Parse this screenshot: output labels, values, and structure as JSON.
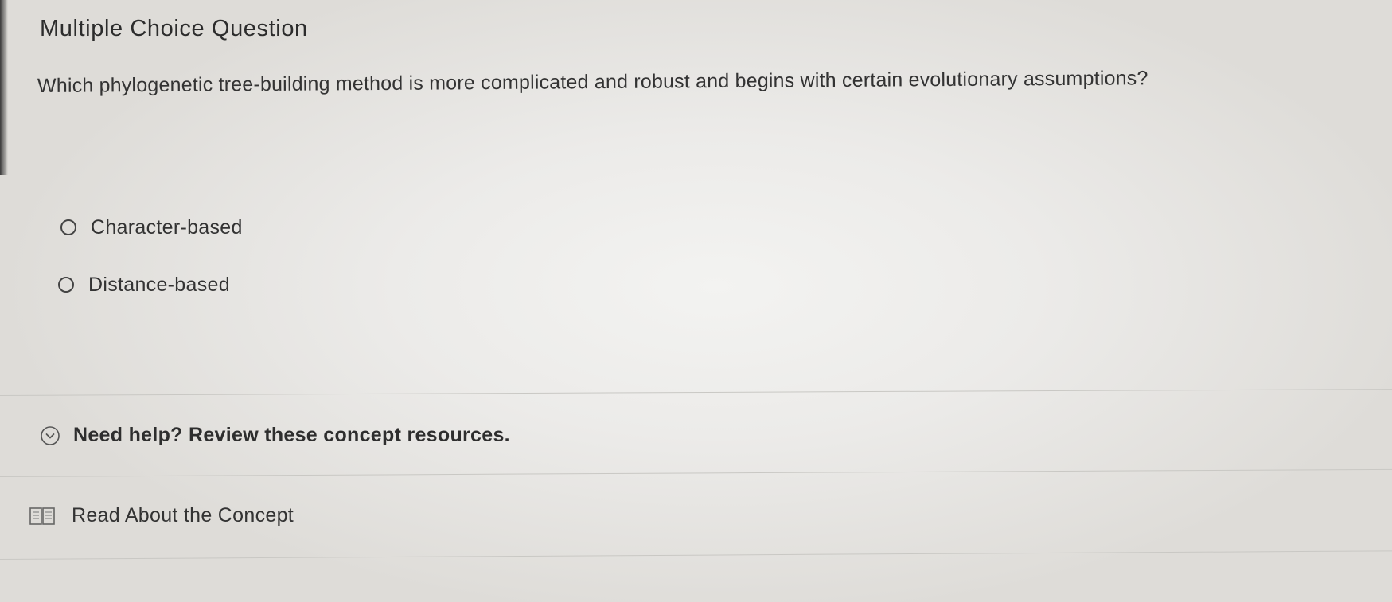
{
  "question": {
    "type_label": "Multiple Choice Question",
    "prompt": "Which phylogenetic tree-building method is more complicated and robust and begins with certain evolutionary assumptions?",
    "options": [
      {
        "label": "Character-based",
        "selected": false
      },
      {
        "label": "Distance-based",
        "selected": false
      }
    ]
  },
  "help": {
    "toggle_label": "Need help? Review these concept resources.",
    "toggle_icon": "chevron-down-circle-icon",
    "resources": [
      {
        "label": "Read About the Concept",
        "icon": "book-icon"
      }
    ]
  },
  "colors": {
    "text": "#2e2e2e",
    "divider": "#c9c8c4"
  }
}
